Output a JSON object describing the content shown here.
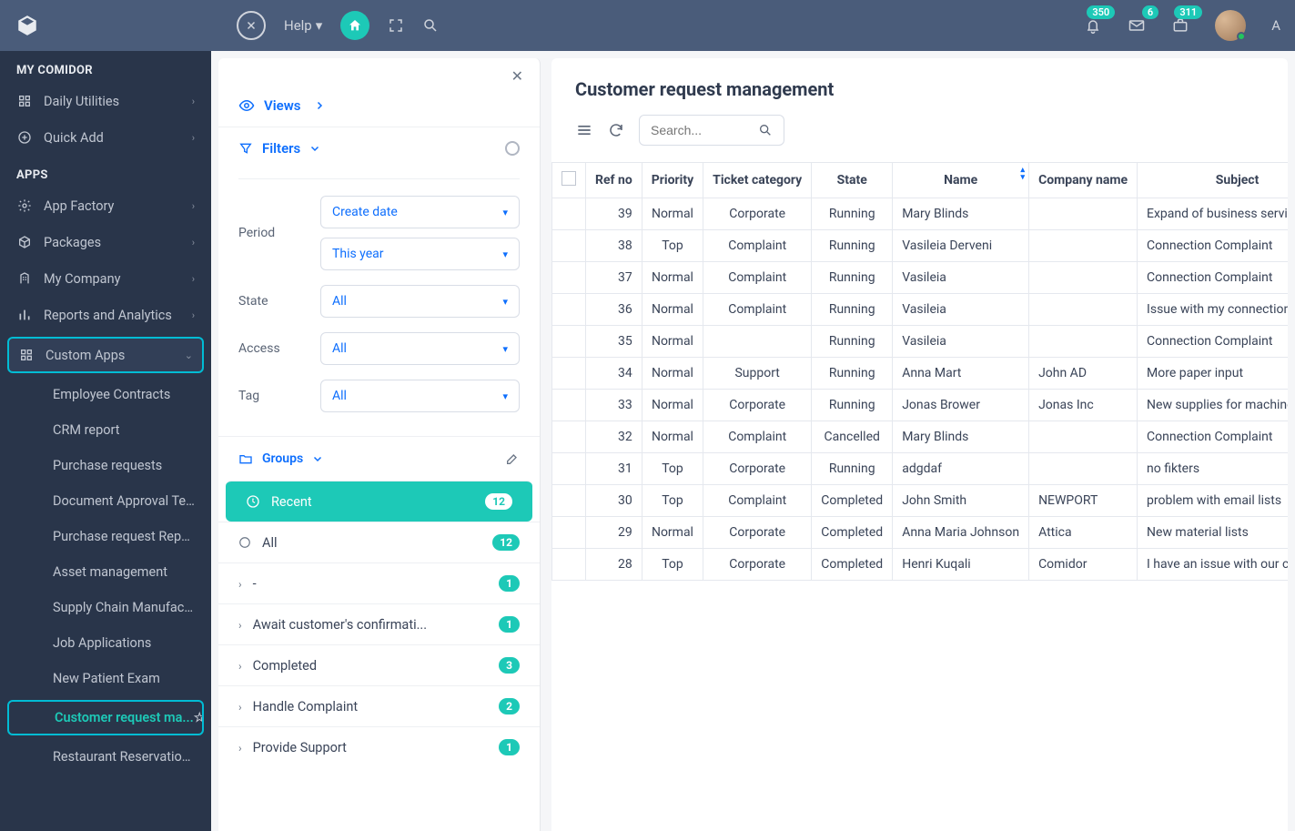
{
  "topbar": {
    "help_label": "Help",
    "notifications": {
      "bell": "350",
      "mail": "6",
      "case": "311"
    },
    "user_initial": "A"
  },
  "sidebar": {
    "section1": "MY COMIDOR",
    "daily_utilities": "Daily Utilities",
    "quick_add": "Quick Add",
    "section2": "APPS",
    "app_factory": "App Factory",
    "packages": "Packages",
    "my_company": "My Company",
    "reports": "Reports and Analytics",
    "custom_apps": "Custom Apps",
    "sub": {
      "employee_contracts": "Employee Contracts",
      "crm_report": "CRM report",
      "purchase_requests": "Purchase requests",
      "doc_approval": "Document Approval Test",
      "purchase_request_report": "Purchase request Report",
      "asset_mgmt": "Asset management",
      "supply_chain": "Supply Chain Manufactu...",
      "job_apps": "Job Applications",
      "new_patient": "New Patient Exam",
      "customer_request": "Customer request ma...",
      "restaurant": "Restaurant Reservation ..."
    }
  },
  "mid": {
    "views": "Views",
    "filters": "Filters",
    "period_label": "Period",
    "period_sel1": "Create date",
    "period_sel2": "This year",
    "state_label": "State",
    "state_sel": "All",
    "access_label": "Access",
    "access_sel": "All",
    "tag_label": "Tag",
    "tag_sel": "All",
    "groups": "Groups",
    "group_items": [
      {
        "label": "Recent",
        "count": "12",
        "active": true,
        "icon": "clock"
      },
      {
        "label": "All",
        "count": "12",
        "icon": "radio"
      },
      {
        "label": "-",
        "count": "1",
        "icon": "chev"
      },
      {
        "label": "Await customer's confirmati...",
        "count": "1",
        "icon": "chev"
      },
      {
        "label": "Completed",
        "count": "3",
        "icon": "chev"
      },
      {
        "label": "Handle Complaint",
        "count": "2",
        "icon": "chev"
      },
      {
        "label": "Provide Support",
        "count": "1",
        "icon": "chev"
      }
    ]
  },
  "main": {
    "title": "Customer request management",
    "search_placeholder": "Search...",
    "columns": {
      "refno": "Ref no",
      "priority": "Priority",
      "category": "Ticket category",
      "state": "State",
      "name": "Name",
      "company": "Company name",
      "subject": "Subject"
    },
    "rows": [
      {
        "ref": "39",
        "priority": "Normal",
        "category": "Corporate",
        "state": "Running",
        "name": "Mary Blinds",
        "company": "",
        "subject": "Expand of business services"
      },
      {
        "ref": "38",
        "priority": "Top",
        "category": "Complaint",
        "state": "Running",
        "name": "Vasileia Derveni",
        "company": "",
        "subject": "Connection Complaint"
      },
      {
        "ref": "37",
        "priority": "Normal",
        "category": "Complaint",
        "state": "Running",
        "name": "Vasileia",
        "company": "",
        "subject": "Connection Complaint"
      },
      {
        "ref": "36",
        "priority": "Normal",
        "category": "Complaint",
        "state": "Running",
        "name": "Vasileia",
        "company": "",
        "subject": "Issue with my connection"
      },
      {
        "ref": "35",
        "priority": "Normal",
        "category": "",
        "state": "Running",
        "name": "Vasileia",
        "company": "",
        "subject": "Connection Complaint"
      },
      {
        "ref": "34",
        "priority": "Normal",
        "category": "Support",
        "state": "Running",
        "name": "Anna Mart",
        "company": "John AD",
        "subject": "More paper input"
      },
      {
        "ref": "33",
        "priority": "Normal",
        "category": "Corporate",
        "state": "Running",
        "name": "Jonas Brower",
        "company": "Jonas Inc",
        "subject": "New supplies for machines"
      },
      {
        "ref": "32",
        "priority": "Normal",
        "category": "Complaint",
        "state": "Cancelled",
        "name": "Mary Blinds",
        "company": "",
        "subject": "Connection Complaint"
      },
      {
        "ref": "31",
        "priority": "Top",
        "category": "Corporate",
        "state": "Running",
        "name": "adgdaf",
        "company": "",
        "subject": "no fikters"
      },
      {
        "ref": "30",
        "priority": "Top",
        "category": "Complaint",
        "state": "Completed",
        "name": "John Smith",
        "company": "NEWPORT",
        "subject": "problem with email lists"
      },
      {
        "ref": "29",
        "priority": "Normal",
        "category": "Corporate",
        "state": "Completed",
        "name": "Anna Maria Johnson",
        "company": "Attica",
        "subject": "New material lists"
      },
      {
        "ref": "28",
        "priority": "Top",
        "category": "Corporate",
        "state": "Completed",
        "name": "Henri Kuqali",
        "company": "Comidor",
        "subject": "I have an issue with our corpor..."
      }
    ]
  }
}
